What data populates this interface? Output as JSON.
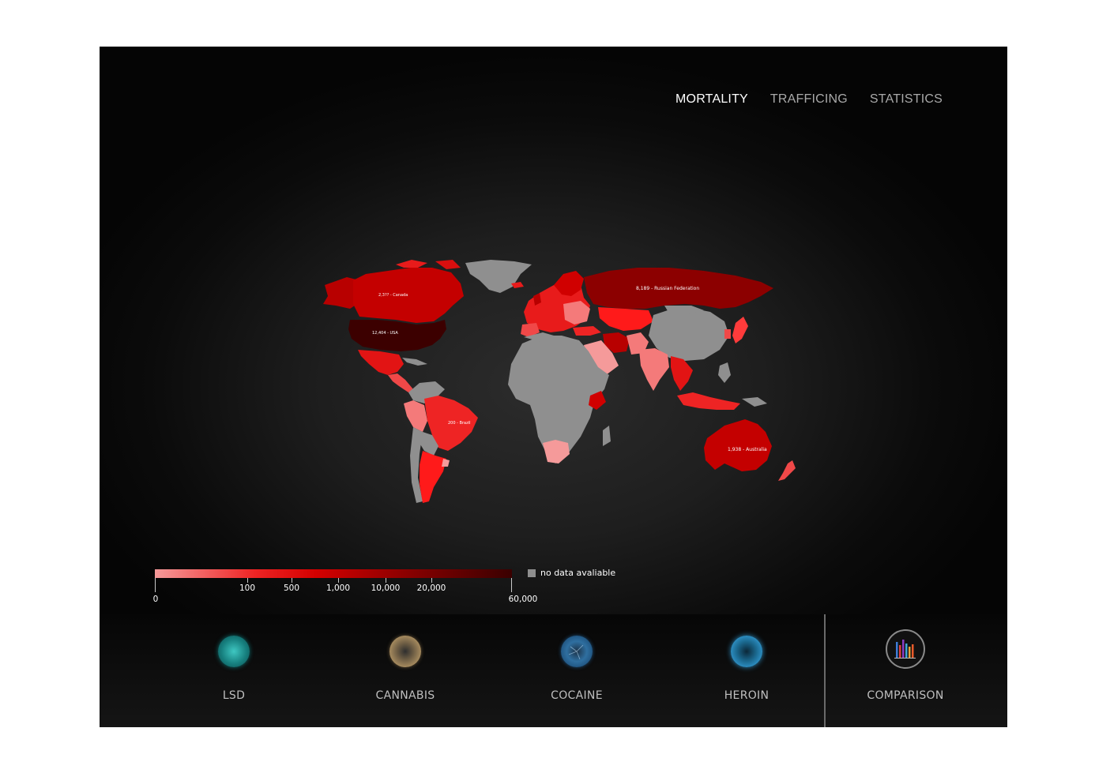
{
  "nav": {
    "items": [
      {
        "label": "MORTALITY",
        "active": true
      },
      {
        "label": "TRAFFICING",
        "active": false
      },
      {
        "label": "STATISTICS",
        "active": false
      }
    ]
  },
  "map": {
    "labels": {
      "canada": "2,3?? - Canada",
      "usa": "12,404 - USA",
      "russia": "8,189 - Russian Federation",
      "brazil": "200 - Brazil",
      "australia": "1,938 - Australia"
    },
    "colors": {
      "no_data": "#8f8f8f",
      "lightest": "#f59a9a",
      "mid": "#ee2424",
      "dark": "#8c0000",
      "darkest": "#3a0000"
    }
  },
  "legend": {
    "ticks": [
      "0",
      "100",
      "500",
      "1,000",
      "10,000",
      "20,000",
      "60,000"
    ],
    "no_data_label": "no data avaliable"
  },
  "drugs": [
    {
      "label": "LSD",
      "icon": "lsd-icon"
    },
    {
      "label": "CANNABIS",
      "icon": "cannabis-icon"
    },
    {
      "label": "COCAINE",
      "icon": "cocaine-icon"
    },
    {
      "label": "HEROIN",
      "icon": "heroin-icon"
    }
  ],
  "comparison": {
    "label": "COMPARISON",
    "icon": "bar-chart-icon"
  }
}
